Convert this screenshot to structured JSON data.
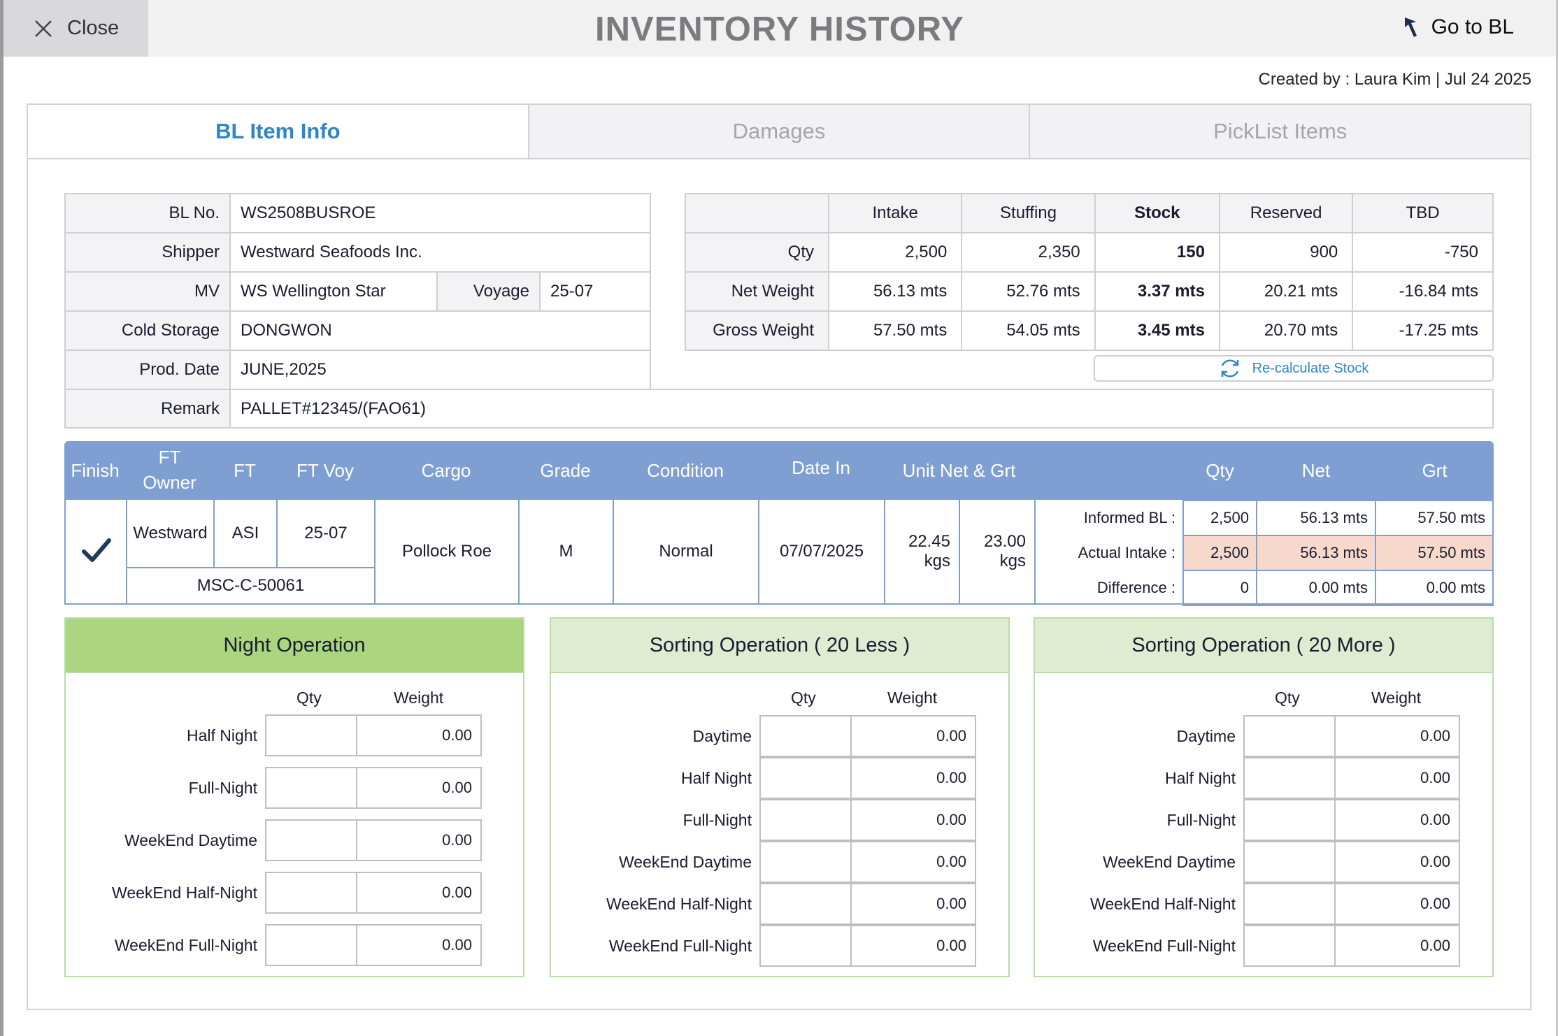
{
  "header": {
    "close_label": "Close",
    "title": "INVENTORY HISTORY",
    "goto_label": "Go to BL"
  },
  "created": "Created by : Laura Kim  |  Jul 24 2025",
  "tabs": [
    "BL Item Info",
    "Damages",
    "PickList Items"
  ],
  "bl_info": {
    "bl_no_label": "BL No.",
    "bl_no": "WS2508BUSROE",
    "shipper_label": "Shipper",
    "shipper": "Westward Seafoods Inc.",
    "mv_label": "MV",
    "mv": "WS Wellington Star",
    "voyage_label": "Voyage",
    "voyage": "25-07",
    "cold_storage_label": "Cold Storage",
    "cold_storage": "DONGWON",
    "prod_date_label": "Prod. Date",
    "prod_date": "JUNE,2025",
    "remark_label": "Remark",
    "remark": "PALLET#12345/(FAO61)"
  },
  "stock": {
    "columns": [
      "Intake",
      "Stuffing",
      "Stock",
      "Reserved",
      "TBD"
    ],
    "rows": [
      {
        "label": "Qty",
        "values": [
          "2,500",
          "2,350",
          "150",
          "900",
          "-750"
        ]
      },
      {
        "label": "Net Weight",
        "values": [
          "56.13 mts",
          "52.76 mts",
          "3.37 mts",
          "20.21 mts",
          "-16.84 mts"
        ]
      },
      {
        "label": "Gross Weight",
        "values": [
          "57.50 mts",
          "54.05 mts",
          "3.45 mts",
          "20.70 mts",
          "-17.25 mts"
        ]
      }
    ],
    "recalc_label": "Re-calculate Stock"
  },
  "grid": {
    "headers": {
      "finish": "Finish",
      "ft_owner_1": "FT",
      "ft_owner_2": "Owner",
      "ft": "FT",
      "ft_voy": "FT Voy",
      "cargo": "Cargo",
      "grade": "Grade",
      "condition": "Condition",
      "date_in": "Date  In",
      "unit": "Unit Net & Grt",
      "qty": "Qty",
      "net": "Net",
      "grt": "Grt"
    },
    "row": {
      "ft_owner": "Westward",
      "ft": "ASI",
      "ft_voy": "25-07",
      "container": "MSC-C-50061",
      "cargo": "Pollock Roe",
      "grade": "M",
      "condition": "Normal",
      "date_in": "07/07/2025",
      "unit_net": "22.45",
      "unit_net_unit": "kgs",
      "unit_grt": "23.00",
      "unit_grt_unit": "kgs"
    },
    "comparison": [
      {
        "label": "Informed BL :",
        "qty": "2,500",
        "net": "56.13 mts",
        "grt": "57.50 mts"
      },
      {
        "label": "Actual Intake :",
        "qty": "2,500",
        "net": "56.13 mts",
        "grt": "57.50 mts"
      },
      {
        "label": "Difference :",
        "qty": "0",
        "net": "0.00 mts",
        "grt": "0.00 mts"
      }
    ]
  },
  "panels": [
    {
      "title": "Night Operation",
      "qty_label": "Qty",
      "weight_label": "Weight",
      "rows": [
        {
          "label": "Half Night",
          "qty": "",
          "weight": "0.00"
        },
        {
          "label": "Full-Night",
          "qty": "",
          "weight": "0.00"
        },
        {
          "label": "WeekEnd Daytime",
          "qty": "",
          "weight": "0.00"
        },
        {
          "label": "WeekEnd Half-Night",
          "qty": "",
          "weight": "0.00"
        },
        {
          "label": "WeekEnd Full-Night",
          "qty": "",
          "weight": "0.00"
        }
      ]
    },
    {
      "title": "Sorting Operation ( 20 Less )",
      "qty_label": "Qty",
      "weight_label": "Weight",
      "rows": [
        {
          "label": "Daytime",
          "qty": "",
          "weight": "0.00"
        },
        {
          "label": "Half Night",
          "qty": "",
          "weight": "0.00"
        },
        {
          "label": "Full-Night",
          "qty": "",
          "weight": "0.00"
        },
        {
          "label": "WeekEnd Daytime",
          "qty": "",
          "weight": "0.00"
        },
        {
          "label": "WeekEnd Half-Night",
          "qty": "",
          "weight": "0.00"
        },
        {
          "label": "WeekEnd Full-Night",
          "qty": "",
          "weight": "0.00"
        }
      ]
    },
    {
      "title": "Sorting Operation ( 20 More )",
      "qty_label": "Qty",
      "weight_label": "Weight",
      "rows": [
        {
          "label": "Daytime",
          "qty": "",
          "weight": "0.00"
        },
        {
          "label": "Half Night",
          "qty": "",
          "weight": "0.00"
        },
        {
          "label": "Full-Night",
          "qty": "",
          "weight": "0.00"
        },
        {
          "label": "WeekEnd Daytime",
          "qty": "",
          "weight": "0.00"
        },
        {
          "label": "WeekEnd Half-Night",
          "qty": "",
          "weight": "0.00"
        },
        {
          "label": "WeekEnd Full-Night",
          "qty": "",
          "weight": "0.00"
        }
      ]
    }
  ],
  "colors": {
    "accent": "#2e86c9",
    "grid_header": "#7f9fd2",
    "panel_strong": "#abd57f",
    "panel_light": "#dfecd2",
    "highlight": "#f7d9cc"
  }
}
